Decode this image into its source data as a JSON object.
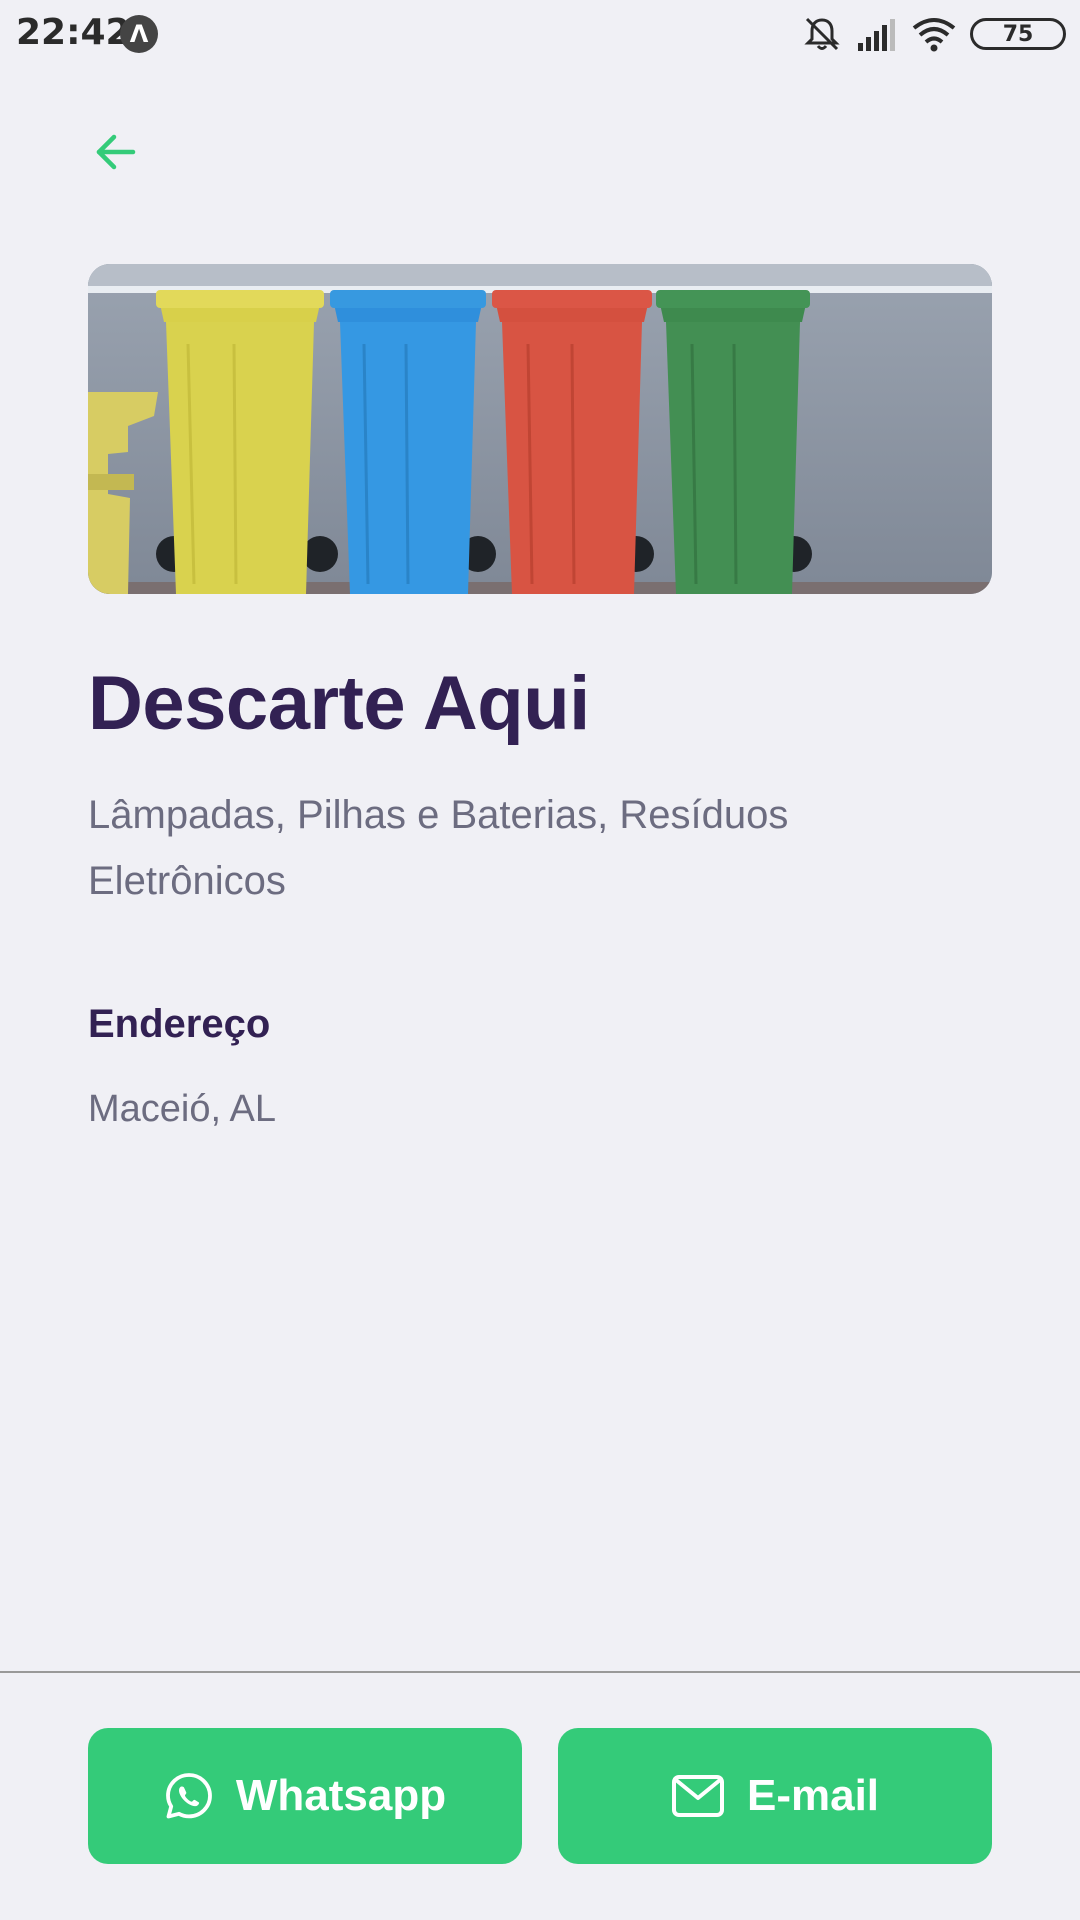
{
  "status_bar": {
    "time": "22:42",
    "app_icon_glyph": "Λ",
    "battery": "75",
    "icons": [
      "app-notification-icon",
      "mute-icon",
      "signal-icon",
      "wifi-icon",
      "battery-icon"
    ]
  },
  "header": {
    "back_icon": "arrow-left-icon",
    "accent_color": "#34CB79"
  },
  "point": {
    "name": "Descarte Aqui",
    "items": "Lâmpadas, Pilhas e Baterias, Resíduos Eletrônicos",
    "address_heading": "Endereço",
    "address": "Maceió, AL"
  },
  "footer": {
    "whatsapp_label": "Whatsapp",
    "whatsapp_icon": "whatsapp-icon",
    "email_label": "E-mail",
    "email_icon": "mail-icon",
    "button_color": "#34CB79"
  },
  "colors": {
    "title": "#322153",
    "text": "#6C6C80",
    "background": "#F0F0F5"
  }
}
